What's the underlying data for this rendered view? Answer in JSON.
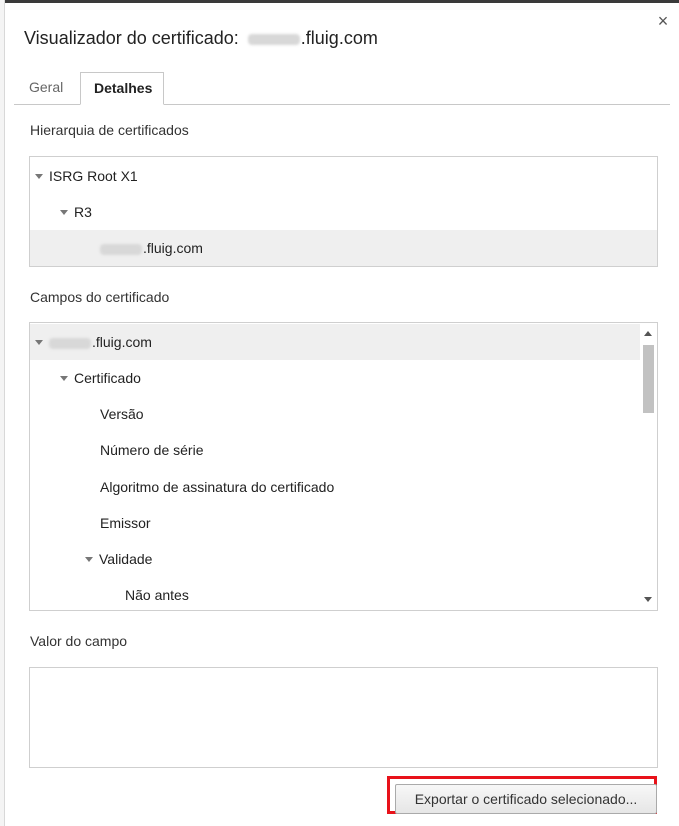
{
  "dialog": {
    "title_prefix": "Visualizador do certificado: ",
    "title_domain": ".fluig.com",
    "close_glyph": "×"
  },
  "tabs": [
    {
      "label": "Geral",
      "active": false
    },
    {
      "label": "Detalhes",
      "active": true
    }
  ],
  "hierarchy": {
    "label": "Hierarquia de certificados",
    "items": [
      {
        "label": "ISRG Root X1",
        "level": 0,
        "expanded": true,
        "selected": false
      },
      {
        "label": "R3",
        "level": 1,
        "expanded": true,
        "selected": false
      },
      {
        "label": ".fluig.com",
        "level": 2,
        "expanded": false,
        "selected": true
      }
    ]
  },
  "fields": {
    "label": "Campos do certificado",
    "items": [
      {
        "label": ".fluig.com",
        "level": 0,
        "expanded": true,
        "selected": true
      },
      {
        "label": "Certificado",
        "level": 1,
        "expanded": true,
        "selected": false
      },
      {
        "label": "Versão",
        "level": 2,
        "expanded": false,
        "selected": false
      },
      {
        "label": "Número de série",
        "level": 2,
        "expanded": false,
        "selected": false
      },
      {
        "label": "Algoritmo de assinatura do certificado",
        "level": 2,
        "expanded": false,
        "selected": false
      },
      {
        "label": "Emissor",
        "level": 2,
        "expanded": false,
        "selected": false
      },
      {
        "label": "Validade",
        "level": 2,
        "expanded": true,
        "selected": false
      },
      {
        "label": "Não antes",
        "level": 3,
        "expanded": false,
        "selected": false
      }
    ]
  },
  "value": {
    "label": "Valor do campo",
    "text": ""
  },
  "export_button": {
    "label": "Exportar o certificado selecionado...",
    "highlight_color": "#e8121a"
  },
  "icons": {
    "close": "close-icon",
    "expand": "triangle-down-icon",
    "scroll_up": "scroll-up-arrow-icon",
    "scroll_down": "scroll-down-arrow-icon"
  }
}
